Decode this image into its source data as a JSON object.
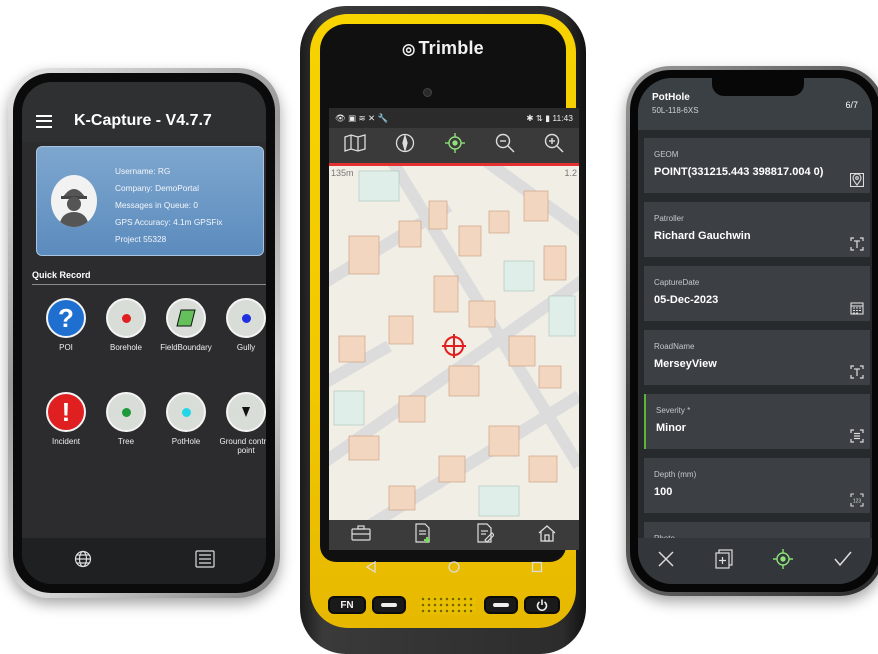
{
  "left_phone": {
    "app_title": "K-Capture - V4.7.7",
    "user_card": {
      "username": "Username: RG",
      "company": "Company: DemoPortal",
      "queue": "Messages in Queue: 0",
      "gps": "GPS Accuracy: 4.1m GPSFix",
      "project": "Project 55328"
    },
    "quick_record_label": "Quick Record",
    "tiles": [
      {
        "label": "POI",
        "icon": "question-icon",
        "color": "#1f6fd0"
      },
      {
        "label": "Borehole",
        "icon": "red-dot-icon",
        "color": "#e02020"
      },
      {
        "label": "FieldBoundary",
        "icon": "polygon-icon",
        "color": "#63c05b"
      },
      {
        "label": "Gully",
        "icon": "blue-dot-icon",
        "color": "#2030e0"
      },
      {
        "label": "Incident",
        "icon": "exclamation-icon",
        "color": "#e02020"
      },
      {
        "label": "Tree",
        "icon": "green-dot-icon",
        "color": "#1f9a3a"
      },
      {
        "label": "PotHole",
        "icon": "cyan-dot-icon",
        "color": "#22d6e8"
      },
      {
        "label": "Ground control point",
        "icon": "pin-icon",
        "color": "#111111"
      }
    ],
    "bottom_icons": [
      "globe-icon",
      "list-icon"
    ]
  },
  "trimble": {
    "brand": "Trimble",
    "status_time": "11:43",
    "toolbar_icons": [
      "map-layers-icon",
      "compass-icon",
      "gps-locate-icon",
      "zoom-out-icon",
      "zoom-in-icon"
    ],
    "scale_left": "135m",
    "scale_right": "1.2",
    "bottom_icons": [
      "briefcase-icon",
      "new-form-icon",
      "edit-form-icon",
      "home-icon"
    ],
    "fn_key": "FN"
  },
  "right_phone": {
    "form_title": "PotHole",
    "form_id": "50L-118-6XS",
    "page": "6/7",
    "fields": [
      {
        "label": "GEOM",
        "value": "POINT(331215.443 398817.004 0)",
        "icon": "location-pin-icon"
      },
      {
        "label": "Patroller",
        "value": "Richard Gauchwin",
        "icon": "text-field-icon"
      },
      {
        "label": "CaptureDate",
        "value": "05-Dec-2023",
        "icon": "calendar-icon"
      },
      {
        "label": "RoadName",
        "value": "MerseyView",
        "icon": "text-field-icon"
      },
      {
        "label": "Severity *",
        "value": "Minor",
        "icon": "list-select-icon"
      },
      {
        "label": "Depth (mm)",
        "value": "100",
        "icon": "number-field-icon"
      },
      {
        "label": "Photo",
        "value": "",
        "icon": ""
      }
    ],
    "bottom_icons": [
      "close-icon",
      "copy-form-icon",
      "gps-target-icon",
      "check-icon"
    ]
  },
  "colors": {
    "trimble_yellow": "#f2c800",
    "accent_red": "#e53030",
    "accent_green": "#5fb33a"
  }
}
